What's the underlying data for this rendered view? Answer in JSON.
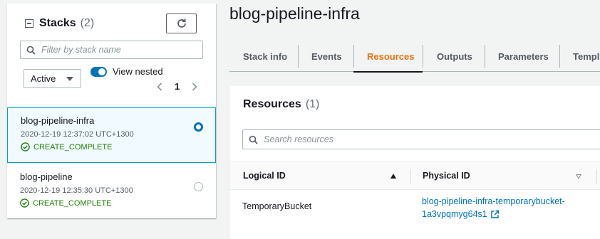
{
  "sidebar": {
    "title": "Stacks",
    "count": "(2)",
    "filter_placeholder": "Filter by stack name",
    "status_filter": "Active",
    "view_nested_label": "View nested",
    "view_nested_on": true,
    "page": "1",
    "stacks": [
      {
        "name": "blog-pipeline-infra",
        "time": "2020-12-19 12:37:02 UTC+1300",
        "status": "CREATE_COMPLETE",
        "selected": true
      },
      {
        "name": "blog-pipeline",
        "time": "2020-12-19 12:35:30 UTC+1300",
        "status": "CREATE_COMPLETE",
        "selected": false
      }
    ]
  },
  "main": {
    "title": "blog-pipeline-infra",
    "tabs": [
      {
        "label": "Stack info"
      },
      {
        "label": "Events"
      },
      {
        "label": "Resources",
        "active": true
      },
      {
        "label": "Outputs"
      },
      {
        "label": "Parameters"
      },
      {
        "label": "Templ"
      }
    ],
    "resources": {
      "title": "Resources",
      "count": "(1)",
      "search_placeholder": "Search resources",
      "columns": {
        "logical_id": "Logical ID",
        "physical_id": "Physical ID"
      },
      "rows": [
        {
          "logical_id": "TemporaryBucket",
          "physical_id_line1": "blog-pipeline-infra-temporarybucket-",
          "physical_id_line2": "1a3vpqmyg64s1"
        }
      ]
    }
  },
  "colors": {
    "accent": "#0073bb",
    "active_tab": "#ec7211",
    "success": "#1d8102",
    "selected_bg": "#f1faff",
    "selected_border": "#00a1c9"
  },
  "icons": [
    "collapse-icon",
    "refresh-icon",
    "search-icon",
    "caret-down-icon",
    "chevron-left-icon",
    "chevron-right-icon",
    "check-circle-icon",
    "sort-ascending-icon",
    "sort-descending-icon",
    "external-link-icon"
  ]
}
